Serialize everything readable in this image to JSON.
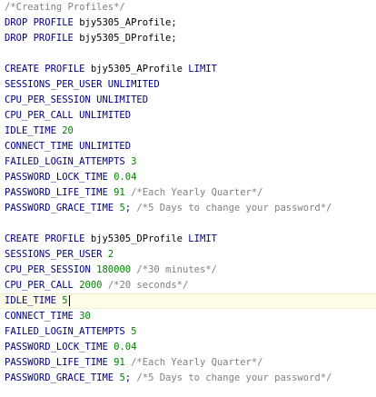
{
  "editor": {
    "lines": [
      [
        {
          "t": "/*Creating Profiles*/",
          "c": "cm"
        }
      ],
      [
        {
          "t": "DROP PROFILE ",
          "c": "kw"
        },
        {
          "t": "bjy5305_AProfile",
          "c": "id"
        },
        {
          "t": ";",
          "c": "kw"
        }
      ],
      [
        {
          "t": "DROP PROFILE ",
          "c": "kw"
        },
        {
          "t": "bjy5305_DProfile",
          "c": "id"
        },
        {
          "t": ";",
          "c": "kw"
        }
      ],
      [],
      [
        {
          "t": "CREATE PROFILE ",
          "c": "kw"
        },
        {
          "t": "bjy5305_AProfile",
          "c": "id"
        },
        {
          "t": " LIMIT",
          "c": "kw"
        }
      ],
      [
        {
          "t": "SESSIONS_PER_USER UNLIMITED",
          "c": "kw"
        }
      ],
      [
        {
          "t": "CPU_PER_SESSION UNLIMITED",
          "c": "kw"
        }
      ],
      [
        {
          "t": "CPU_PER_CALL UNLIMITED",
          "c": "kw"
        }
      ],
      [
        {
          "t": "IDLE_TIME ",
          "c": "kw"
        },
        {
          "t": "20",
          "c": "num"
        }
      ],
      [
        {
          "t": "CONNECT_TIME UNLIMITED",
          "c": "kw"
        }
      ],
      [
        {
          "t": "FAILED_LOGIN_ATTEMPTS ",
          "c": "kw"
        },
        {
          "t": "3",
          "c": "num"
        }
      ],
      [
        {
          "t": "PASSWORD_LOCK_TIME ",
          "c": "kw"
        },
        {
          "t": "0.04",
          "c": "num"
        }
      ],
      [
        {
          "t": "PASSWORD_LIFE_TIME ",
          "c": "kw"
        },
        {
          "t": "91",
          "c": "num"
        },
        {
          "t": " ",
          "c": "kw"
        },
        {
          "t": "/*Each Yearly Quarter*/",
          "c": "cm"
        }
      ],
      [
        {
          "t": "PASSWORD_GRACE_TIME ",
          "c": "kw"
        },
        {
          "t": "5",
          "c": "num"
        },
        {
          "t": "; ",
          "c": "kw"
        },
        {
          "t": "/*5 Days to change your password*/",
          "c": "cm"
        }
      ],
      [],
      [
        {
          "t": "CREATE PROFILE ",
          "c": "kw"
        },
        {
          "t": "bjy5305_DProfile",
          "c": "id"
        },
        {
          "t": " LIMIT",
          "c": "kw"
        }
      ],
      [
        {
          "t": "SESSIONS_PER_USER ",
          "c": "kw"
        },
        {
          "t": "2",
          "c": "num"
        }
      ],
      [
        {
          "t": "CPU_PER_SESSION ",
          "c": "kw"
        },
        {
          "t": "180000",
          "c": "num"
        },
        {
          "t": " ",
          "c": "kw"
        },
        {
          "t": "/*30 minutes*/",
          "c": "cm"
        }
      ],
      [
        {
          "t": "CPU_PER_CALL ",
          "c": "kw"
        },
        {
          "t": "2000",
          "c": "num"
        },
        {
          "t": " ",
          "c": "kw"
        },
        {
          "t": "/*20 seconds*/",
          "c": "cm"
        }
      ],
      [
        {
          "t": "IDLE_TIME ",
          "c": "kw"
        },
        {
          "t": "5",
          "c": "num"
        }
      ],
      [
        {
          "t": "CONNECT_TIME ",
          "c": "kw"
        },
        {
          "t": "30",
          "c": "num"
        }
      ],
      [
        {
          "t": "FAILED_LOGIN_ATTEMPTS ",
          "c": "kw"
        },
        {
          "t": "5",
          "c": "num"
        }
      ],
      [
        {
          "t": "PASSWORD_LOCK_TIME ",
          "c": "kw"
        },
        {
          "t": "0.04",
          "c": "num"
        }
      ],
      [
        {
          "t": "PASSWORD_LIFE_TIME ",
          "c": "kw"
        },
        {
          "t": "91",
          "c": "num"
        },
        {
          "t": " ",
          "c": "kw"
        },
        {
          "t": "/*Each Yearly Quarter*/",
          "c": "cm"
        }
      ],
      [
        {
          "t": "PASSWORD_GRACE_TIME ",
          "c": "kw"
        },
        {
          "t": "5",
          "c": "num"
        },
        {
          "t": "; ",
          "c": "kw"
        },
        {
          "t": "/*5 Days to change your password*/",
          "c": "cm"
        }
      ]
    ],
    "active_line": 19,
    "colors": {
      "keyword": "#00007a",
      "identifier": "#000000",
      "number": "#008000",
      "comment": "#808080",
      "active_line_bg": "#fffde8"
    }
  }
}
